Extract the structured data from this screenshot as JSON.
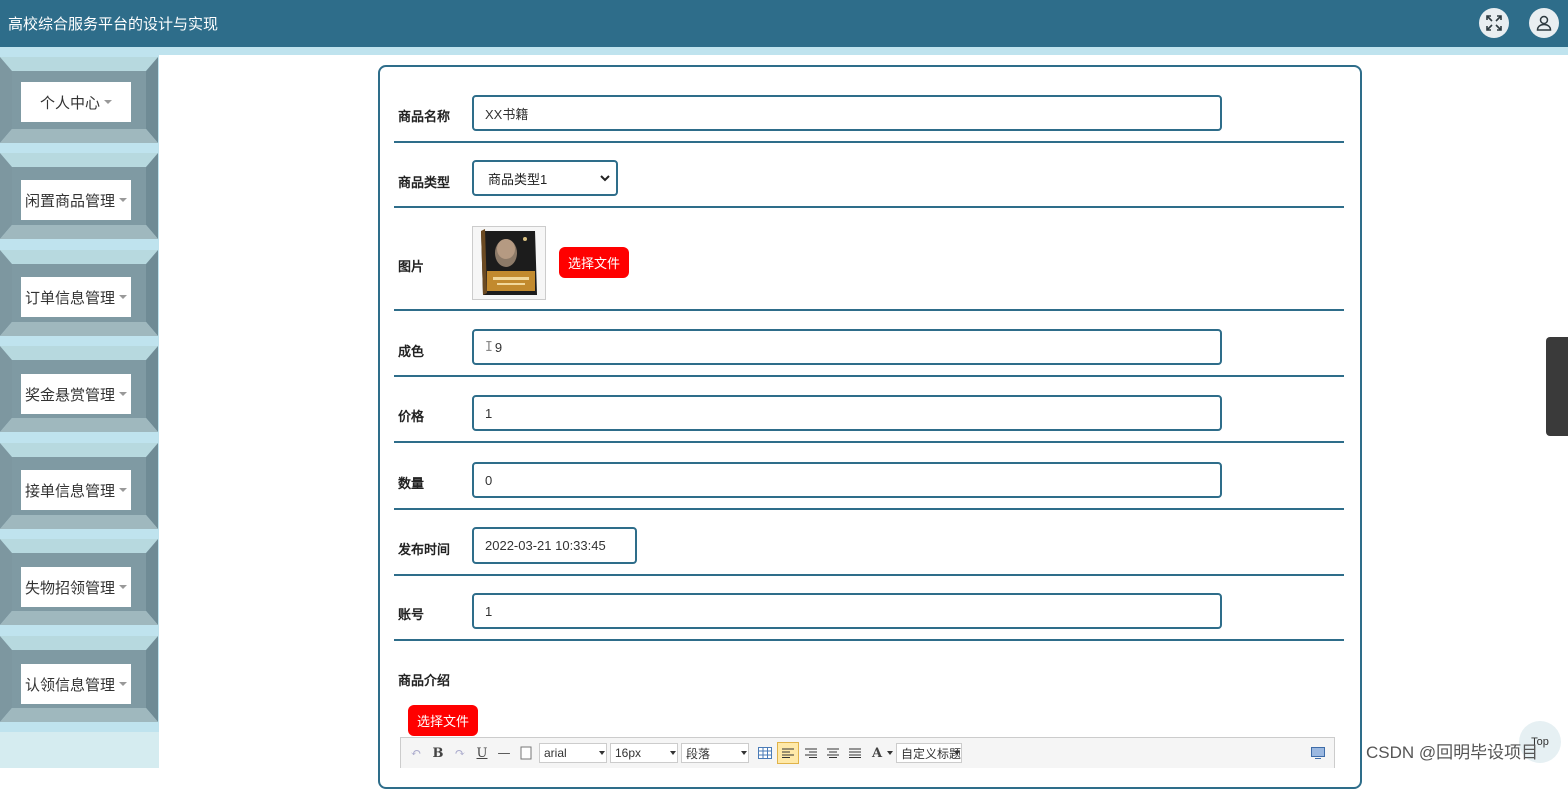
{
  "app": {
    "title": "高校综合服务平台的设计与实现"
  },
  "header": {
    "icons": [
      "fullscreen-icon",
      "user-icon"
    ]
  },
  "sidebar": {
    "items": [
      {
        "label": "个人中心"
      },
      {
        "label": "闲置商品管理"
      },
      {
        "label": "订单信息管理"
      },
      {
        "label": "奖金悬赏管理"
      },
      {
        "label": "接单信息管理"
      },
      {
        "label": "失物招领管理"
      },
      {
        "label": "认领信息管理"
      }
    ]
  },
  "form": {
    "name": {
      "label": "商品名称",
      "value": "XX书籍"
    },
    "type": {
      "label": "商品类型",
      "value": "商品类型1"
    },
    "image": {
      "label": "图片",
      "button": "选择文件"
    },
    "condition": {
      "label": "成色",
      "value": "9"
    },
    "price": {
      "label": "价格",
      "value": "1"
    },
    "quantity": {
      "label": "数量",
      "value": "0"
    },
    "publish_time": {
      "label": "发布时间",
      "value": "2022-03-21 10:33:45"
    },
    "account": {
      "label": "账号",
      "value": "1"
    },
    "intro": {
      "label": "商品介绍",
      "button": "选择文件"
    }
  },
  "editor": {
    "font": "arial",
    "size": "16px",
    "paragraph": "段落",
    "custom_title": "自定义标题"
  },
  "watermark": "CSDN @回明毕设项目",
  "top_button": "Top",
  "colors": {
    "primary": "#2e6d8a",
    "light": "#bfe3ee",
    "button_red": "#ff0000"
  }
}
